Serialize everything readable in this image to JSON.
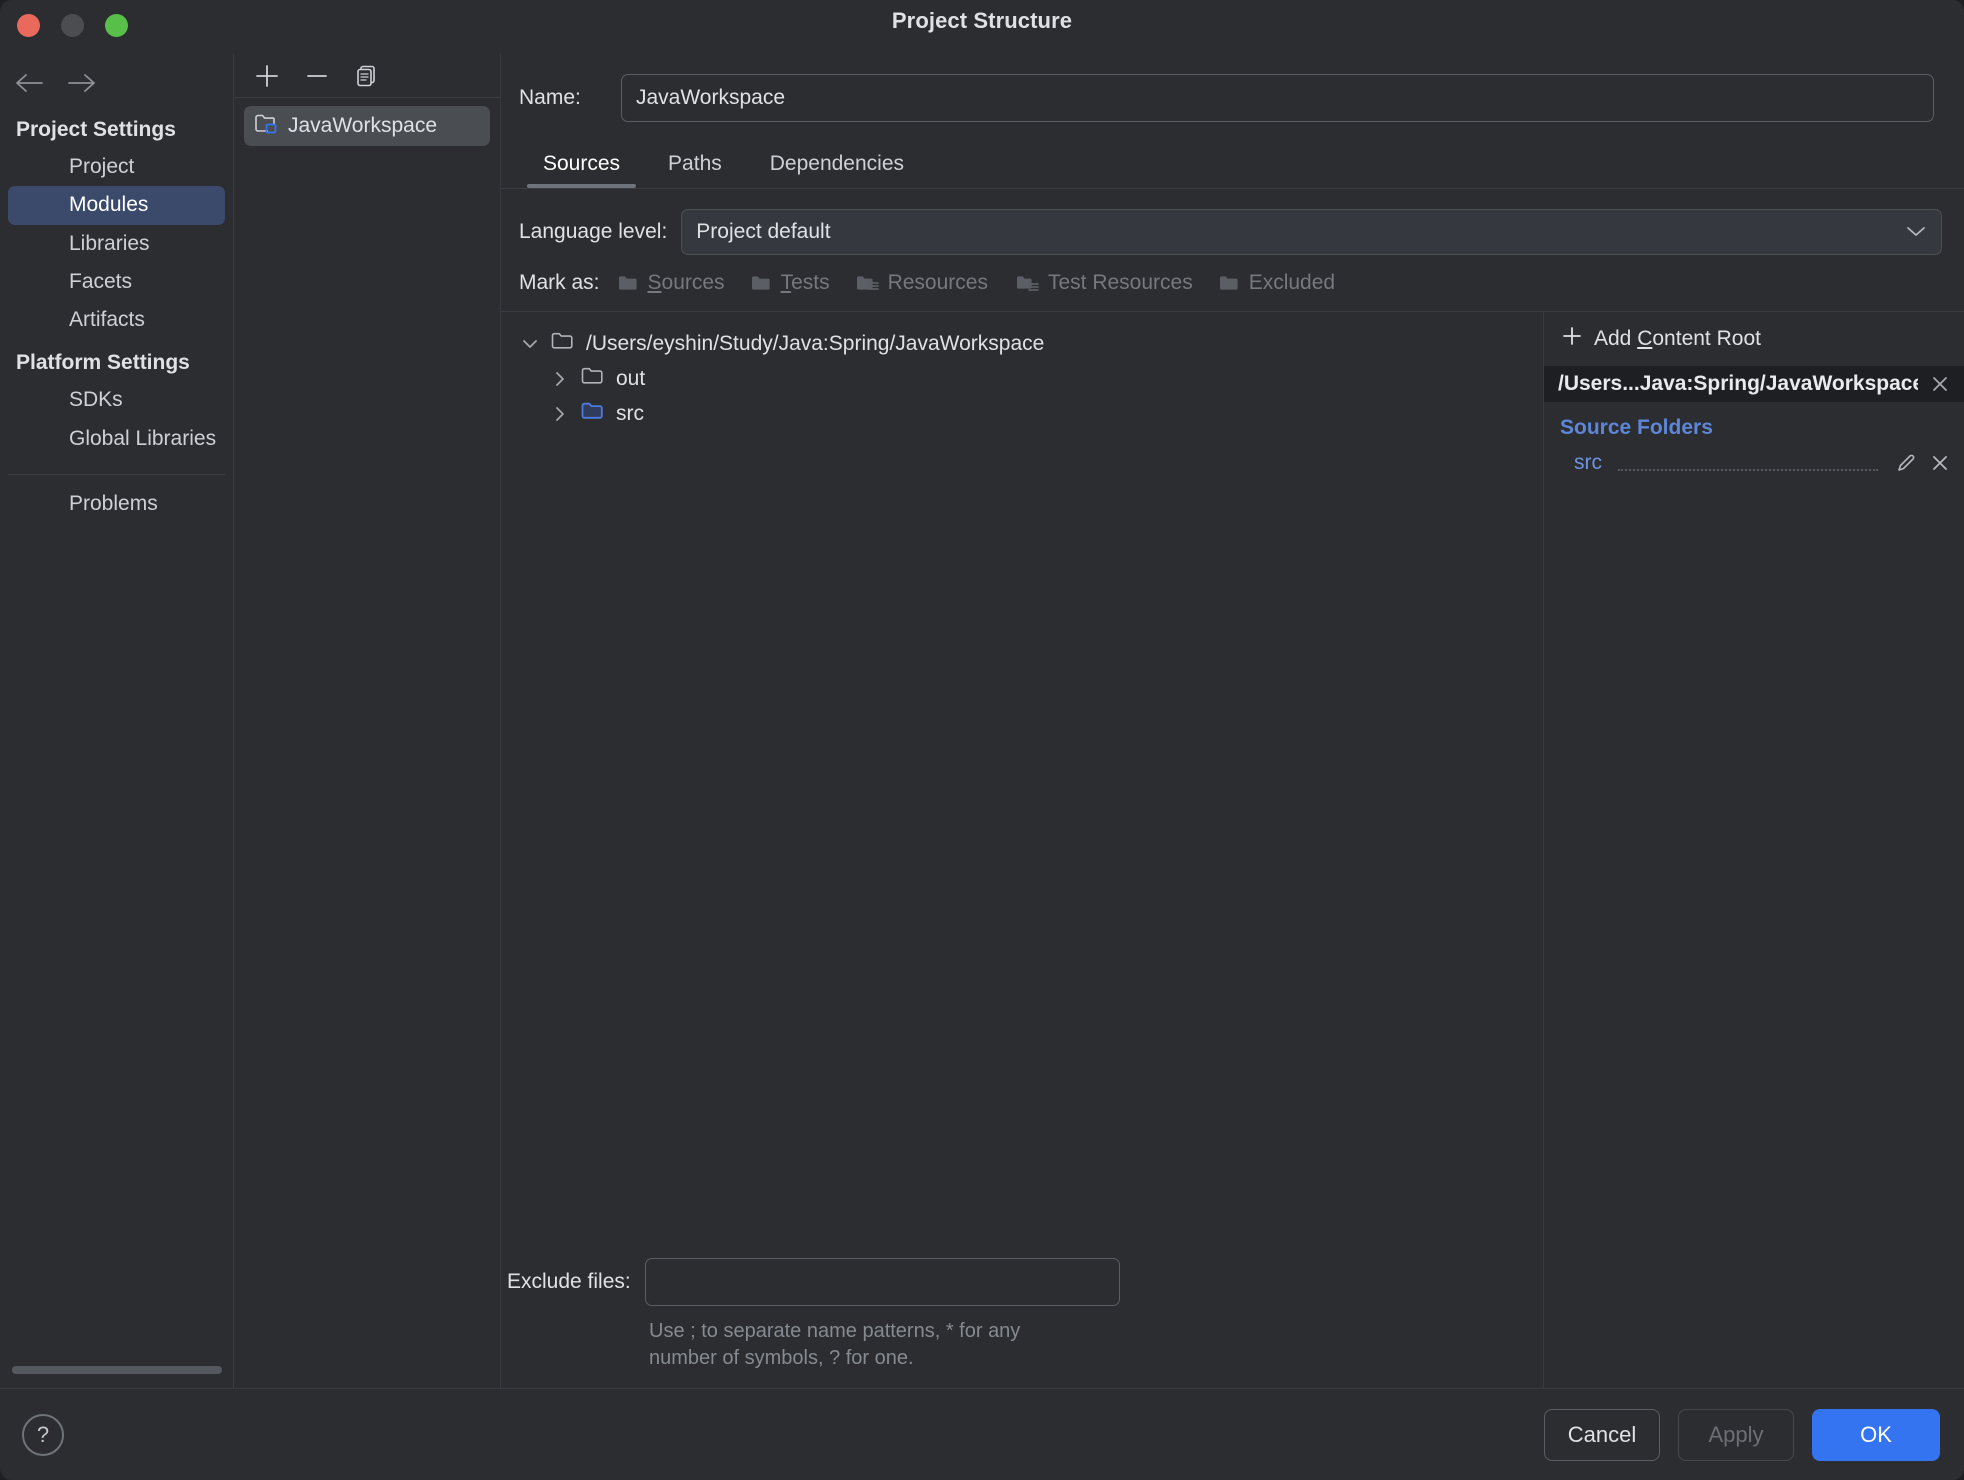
{
  "window": {
    "title": "Project Structure",
    "traffic_lights": [
      "close-red",
      "minimize-yellow",
      "maximize-green"
    ]
  },
  "nav": {
    "back_icon": "arrow-left-icon",
    "forward_icon": "arrow-right-icon"
  },
  "sidebar": {
    "project_settings_header": "Project Settings",
    "project_items": [
      {
        "label": "Project",
        "selected": false
      },
      {
        "label": "Modules",
        "selected": true
      },
      {
        "label": "Libraries",
        "selected": false
      },
      {
        "label": "Facets",
        "selected": false
      },
      {
        "label": "Artifacts",
        "selected": false
      }
    ],
    "platform_settings_header": "Platform Settings",
    "platform_items": [
      {
        "label": "SDKs",
        "selected": false
      },
      {
        "label": "Global Libraries",
        "selected": false
      }
    ],
    "problems_label": "Problems",
    "selected_color": "#3b4a6b"
  },
  "modules_panel": {
    "toolbar": {
      "add_icon": "plus-icon",
      "remove_icon": "minus-icon",
      "copy_icon": "copy-icon"
    },
    "items": [
      {
        "label": "JavaWorkspace",
        "icon": "module-folder-icon",
        "selected": true
      }
    ]
  },
  "main": {
    "name_label": "Name:",
    "name_value": "JavaWorkspace",
    "name_placeholder": "",
    "tabs": [
      {
        "label": "Sources",
        "active": true
      },
      {
        "label": "Paths",
        "active": false
      },
      {
        "label": "Dependencies",
        "active": false
      }
    ],
    "language_level_label": "Language level:",
    "language_level_value": "Project default",
    "mark_as_label": "Mark as:",
    "mark_as_buttons": [
      {
        "label": "Sources",
        "mnemonic": "S",
        "rest": "ources",
        "icon": "folder-sources-icon"
      },
      {
        "label": "Tests",
        "mnemonic": "T",
        "rest": "ests",
        "icon": "folder-tests-icon"
      },
      {
        "label": "Resources",
        "mnemonic": "",
        "rest": "Resources",
        "icon": "folder-resources-icon"
      },
      {
        "label": "Test Resources",
        "mnemonic": "",
        "rest": "Test Resources",
        "icon": "folder-test-resources-icon"
      },
      {
        "label": "Excluded",
        "mnemonic": "",
        "rest": "Excluded",
        "icon": "folder-excluded-icon"
      }
    ],
    "tree": [
      {
        "label": "/Users/eyshin/Study/Java:Spring/JavaWorkspace",
        "level": 0,
        "expanded": true,
        "folder": "plain"
      },
      {
        "label": "out",
        "level": 1,
        "expanded": false,
        "folder": "plain"
      },
      {
        "label": "src",
        "level": 1,
        "expanded": false,
        "folder": "source"
      }
    ],
    "exclude_label": "Exclude files:",
    "exclude_value": "",
    "exclude_placeholder": "",
    "exclude_hint": "Use ; to separate name patterns, * for any number of symbols, ? for one."
  },
  "roots": {
    "add_content_root_prefix": "Add ",
    "add_content_root_mnemonic": "C",
    "add_content_root_suffix": "ontent Root",
    "add_icon": "plus-icon",
    "content_root_path": "/Users...Java:Spring/JavaWorkspace",
    "content_root_close_icon": "close-icon",
    "source_folders_title": "Source Folders",
    "source_folders": [
      {
        "name": "src",
        "edit_icon": "pencil-icon",
        "remove_icon": "close-icon"
      }
    ],
    "link_color": "#6e94e0"
  },
  "footer": {
    "help_label": "?",
    "cancel_label": "Cancel",
    "apply_label": "Apply",
    "apply_disabled": true,
    "ok_label": "OK",
    "ok_color": "#3574f0"
  }
}
